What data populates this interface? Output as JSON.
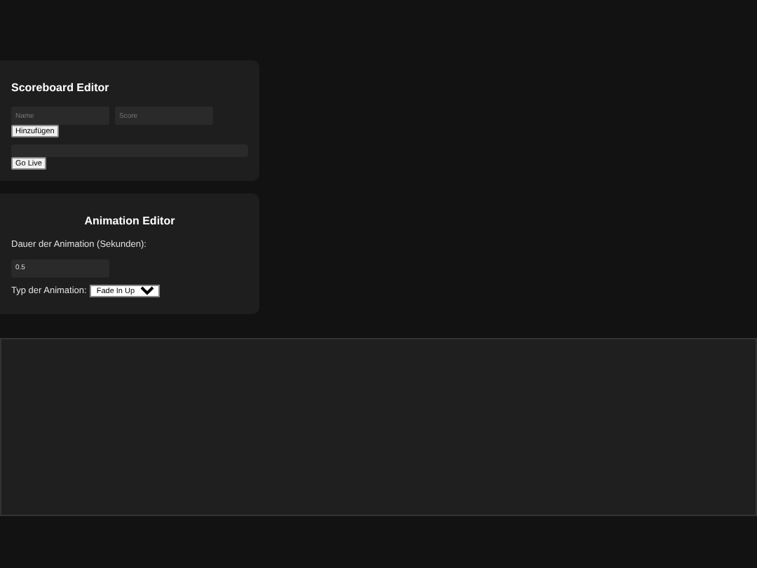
{
  "scoreboard_editor": {
    "title": "Scoreboard Editor",
    "name_field": {
      "placeholder": "Name"
    },
    "score_field": {
      "placeholder": "Score"
    },
    "add_button": "Hinzufügen",
    "go_live_button": "Go Live"
  },
  "animation_editor": {
    "title": "Animation Editor",
    "duration_label": "Dauer der Animation (Sekunden):",
    "duration_field": {
      "value": "0.5"
    },
    "type_label": "Typ der Animation:",
    "type_select": {
      "value": "Fade In Up"
    }
  }
}
